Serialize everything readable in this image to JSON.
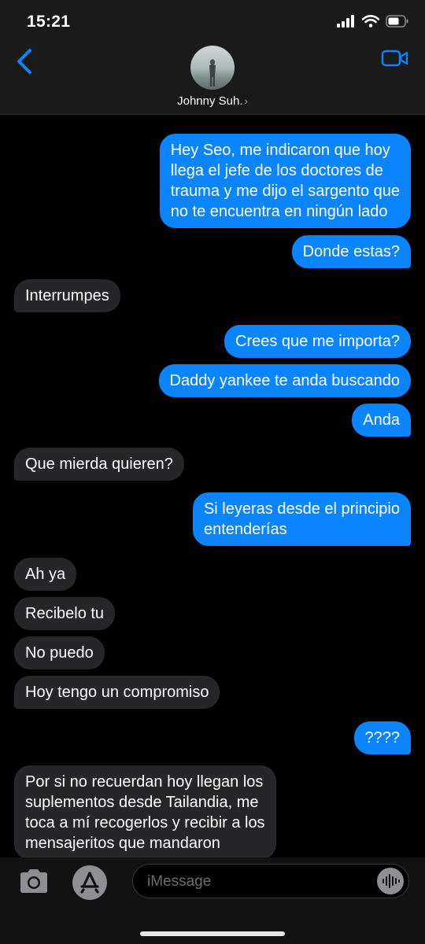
{
  "status_bar": {
    "time": "15:21"
  },
  "contact": {
    "name": "Johnny Suh.",
    "chevron": "›"
  },
  "colors": {
    "outgoing": "#0a84ff",
    "incoming": "#262628",
    "accent": "#0a84ff"
  },
  "messages": [
    {
      "from": "me",
      "text": "Hey Seo, me indicaron que hoy\nllega el jefe de los doctores de\ntrauma y me dijo el sargento que\nno te encuentra en ningún lado"
    },
    {
      "from": "me",
      "text": "Donde estas?"
    },
    {
      "from": "them",
      "text": "Interrumpes"
    },
    {
      "from": "me",
      "text": "Crees que me importa?"
    },
    {
      "from": "me",
      "text": "Daddy yankee te anda buscando"
    },
    {
      "from": "me",
      "text": "Anda"
    },
    {
      "from": "them",
      "text": "Que mierda quieren?"
    },
    {
      "from": "me",
      "text": "Si leyeras desde el principio\nentenderías"
    },
    {
      "from": "them",
      "text": "Ah ya"
    },
    {
      "from": "them",
      "text": "Recibelo tu"
    },
    {
      "from": "them",
      "text": "No puedo"
    },
    {
      "from": "them",
      "text": "Hoy tengo un compromiso"
    },
    {
      "from": "me",
      "text": "????"
    },
    {
      "from": "them",
      "text": "Por si no recuerdan hoy llegan los\nsuplementos desde Tailandia, me\ntoca a mí recogerlos y recibir a los\nmensajeritos que mandaron"
    }
  ],
  "input": {
    "placeholder": "iMessage"
  },
  "icons": {
    "back": "chevron-left-icon",
    "video": "video-camera-icon",
    "camera": "camera-icon",
    "apps": "app-store-icon",
    "audio": "audio-waveform-icon",
    "signal": "cellular-signal-icon",
    "wifi": "wifi-icon",
    "battery": "battery-icon"
  }
}
